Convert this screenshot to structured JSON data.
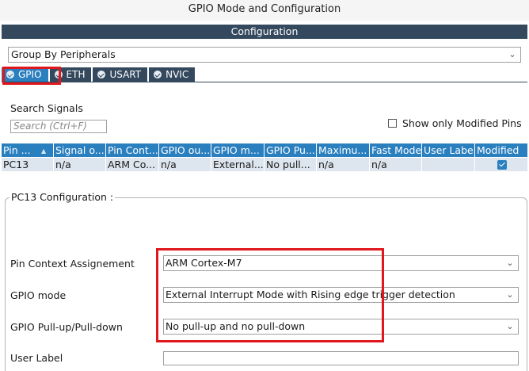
{
  "window": {
    "title": "GPIO Mode and Configuration"
  },
  "config": {
    "header": "Configuration"
  },
  "group_by": {
    "value": "Group By Peripherals"
  },
  "tabs": [
    {
      "label": "GPIO"
    },
    {
      "label": "ETH"
    },
    {
      "label": "USART"
    },
    {
      "label": "NVIC"
    }
  ],
  "search": {
    "label": "Search Signals",
    "placeholder": "Search (Ctrl+F)"
  },
  "show_modified": {
    "label": "Show only Modified Pins",
    "checked": false
  },
  "table": {
    "columns": [
      "Pin ...",
      "Signal o...",
      "Pin Cont...",
      "GPIO ou...",
      "GPIO m...",
      "GPIO Pu...",
      "Maximu...",
      "Fast Mode",
      "User Label",
      "Modified"
    ],
    "rows": [
      {
        "cells": [
          "PC13",
          "n/a",
          "ARM Co...",
          "n/a",
          "External...",
          "No pull...",
          "n/a",
          "n/a",
          "",
          ""
        ],
        "modified": true
      }
    ]
  },
  "pin_config": {
    "legend": "PC13 Configuration :",
    "fields": [
      {
        "label": "Pin Context Assignement",
        "value": "ARM Cortex-M7"
      },
      {
        "label": "GPIO mode",
        "value": "External Interrupt Mode with Rising edge trigger detection"
      },
      {
        "label": "GPIO Pull-up/Pull-down",
        "value": "No pull-up and no pull-down"
      },
      {
        "label": "User Label",
        "value": ""
      }
    ]
  },
  "colors": {
    "header_bg": "#34495e",
    "accent": "#2a7fbf",
    "highlight": "#e0181e",
    "row_bg": "#dde6ee"
  }
}
